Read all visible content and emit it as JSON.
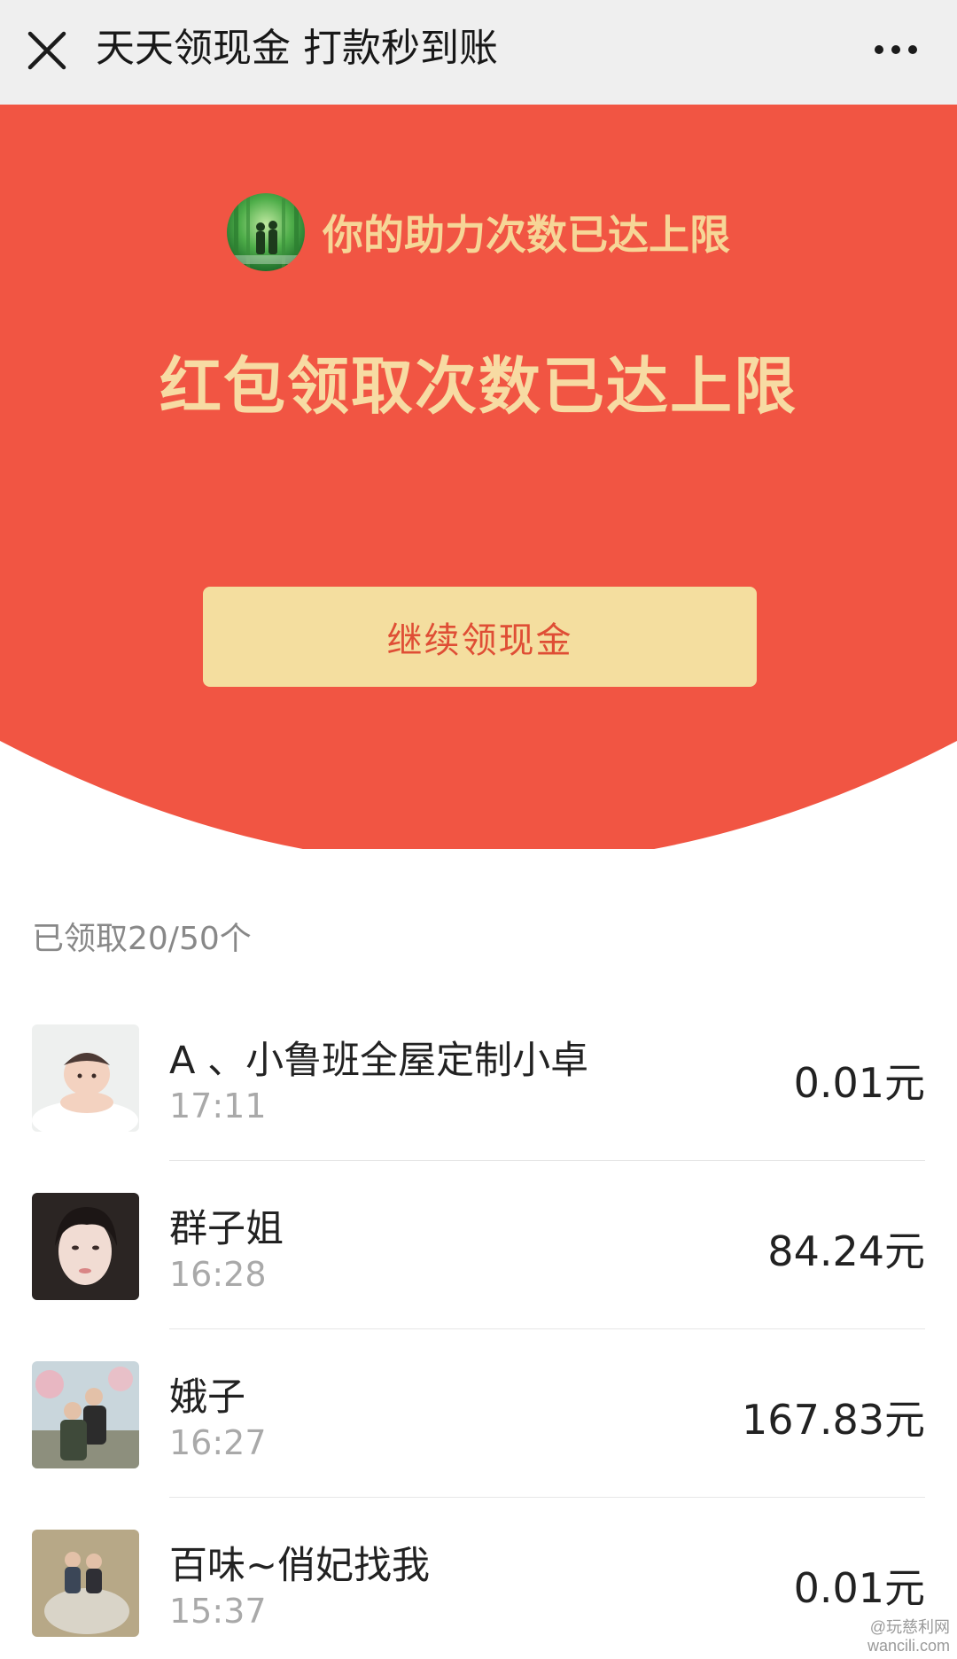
{
  "navbar": {
    "close_icon": "close-icon",
    "title": "天天领现金 打款秒到账",
    "more_icon": "more-dots-icon"
  },
  "hero": {
    "background_color": "#f15543",
    "helper_text": "你的助力次数已达上限",
    "limit_text": "红包领取次数已达上限",
    "continue_button": "继续领现金"
  },
  "received": {
    "label": "已领取20/50个"
  },
  "records": [
    {
      "name": "A 、小鲁班全屋定制小卓",
      "time": "17:11",
      "amount": "0.01元"
    },
    {
      "name": "群子姐",
      "time": "16:28",
      "amount": "84.24元"
    },
    {
      "name": "娥子",
      "time": "16:27",
      "amount": "167.83元"
    },
    {
      "name": "百味~俏妃找我",
      "time": "15:37",
      "amount": "0.01元"
    }
  ],
  "watermark": {
    "line1": "@玩慈利网",
    "line2": "wancili.com"
  }
}
